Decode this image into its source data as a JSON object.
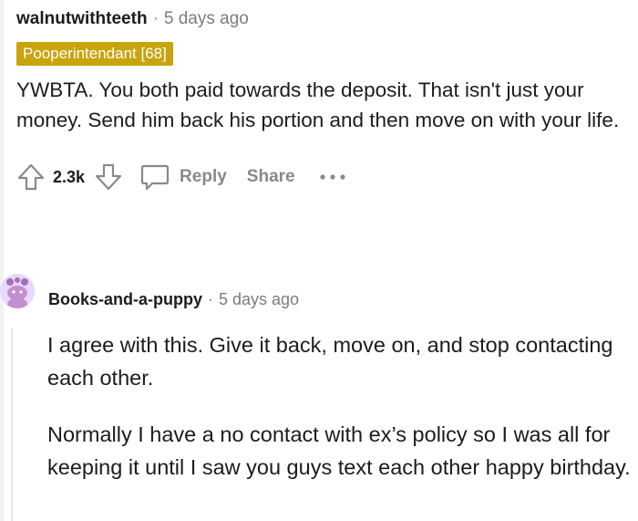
{
  "comment1": {
    "author": "walnutwithteeth",
    "separator": "·",
    "time": "5 days ago",
    "flair": "Pooperintendant [68]",
    "body": "YWBTA. You both paid towards the deposit. That isn't just your money. Send him back his portion and then move on with your life.",
    "votes": "2.3k",
    "reply_label": "Reply",
    "share_label": "Share",
    "more_label": "···",
    "flair_color": "#c8a40d"
  },
  "comment2": {
    "author": "Books-and-a-puppy",
    "separator": "·",
    "time": "5 days ago",
    "paragraphs": [
      "I agree with this. Give it back, move on, and stop contacting each other.",
      "Normally I have a no contact with ex’s policy so I was all for keeping it until I saw you guys text each other happy birthday."
    ]
  },
  "icons": {
    "upvote": "upvote-arrow-icon",
    "downvote": "downvote-arrow-icon",
    "reply": "speech-bubble-icon",
    "more": "more-horizontal-icon",
    "avatar": "snoo-avatar-icon"
  }
}
